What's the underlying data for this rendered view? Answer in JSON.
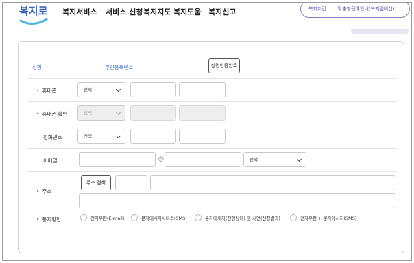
{
  "header": {
    "logo_text": "복지로",
    "nav": [
      "복지서비스",
      "서비스 신청",
      "복지지도",
      "복지도움",
      "복지신고"
    ],
    "pill_links": [
      "복지지갑",
      "맞춤형급여안내(복지멤버십)"
    ]
  },
  "form": {
    "identity": {
      "name_label": "성명",
      "rrn_label": "주민등록번호",
      "verified_button": "실명인증완료"
    },
    "mobile": {
      "label": "휴대폰",
      "select_value": "선택"
    },
    "mobile_confirm": {
      "label": "휴대폰 확인",
      "select_value": "선택"
    },
    "phone": {
      "label": "전화번호",
      "select_value": "선택"
    },
    "email": {
      "label": "이메일",
      "at": "@",
      "select_value": "선택"
    },
    "address": {
      "label": "주소",
      "search_button": "주소 검색"
    },
    "notify": {
      "label": "통지방법",
      "options": [
        "전자우편(E-mail)",
        "문자메시지서비스(SMS)",
        "문자메세지(진행상태) 및 서면(신청결과)",
        "전자우편 + 문자메시지(SMS)"
      ]
    }
  },
  "colors": {
    "required": "#d9234c",
    "link_blue": "#3b6fc4",
    "brand_purple": "#5b4fa0"
  }
}
